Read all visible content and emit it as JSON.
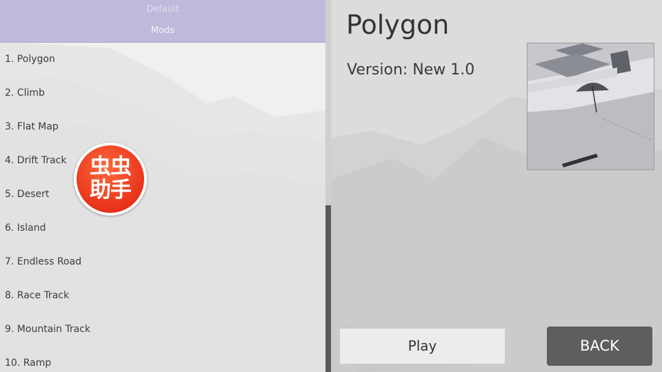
{
  "tabs": {
    "default_label": "Default",
    "mods_label": "Mods"
  },
  "map_list": [
    "1. Polygon",
    "2. Climb",
    "3. Flat Map",
    "4. Drift Track",
    "5. Desert",
    "6. Island",
    "7. Endless Road",
    "8. Race Track",
    "9. Mountain Track",
    "10. Ramp"
  ],
  "detail": {
    "title": "Polygon",
    "version": "Version: New 1.0",
    "play_label": "Play",
    "back_label": "BACK"
  },
  "watermark": {
    "line1": "虫虫",
    "line2": "助手"
  },
  "colors": {
    "tab_bar": "#bdbadb",
    "list_background": "#e6e6e6",
    "back_button": "#5e5e5e",
    "watermark_red": "#e8321a"
  }
}
